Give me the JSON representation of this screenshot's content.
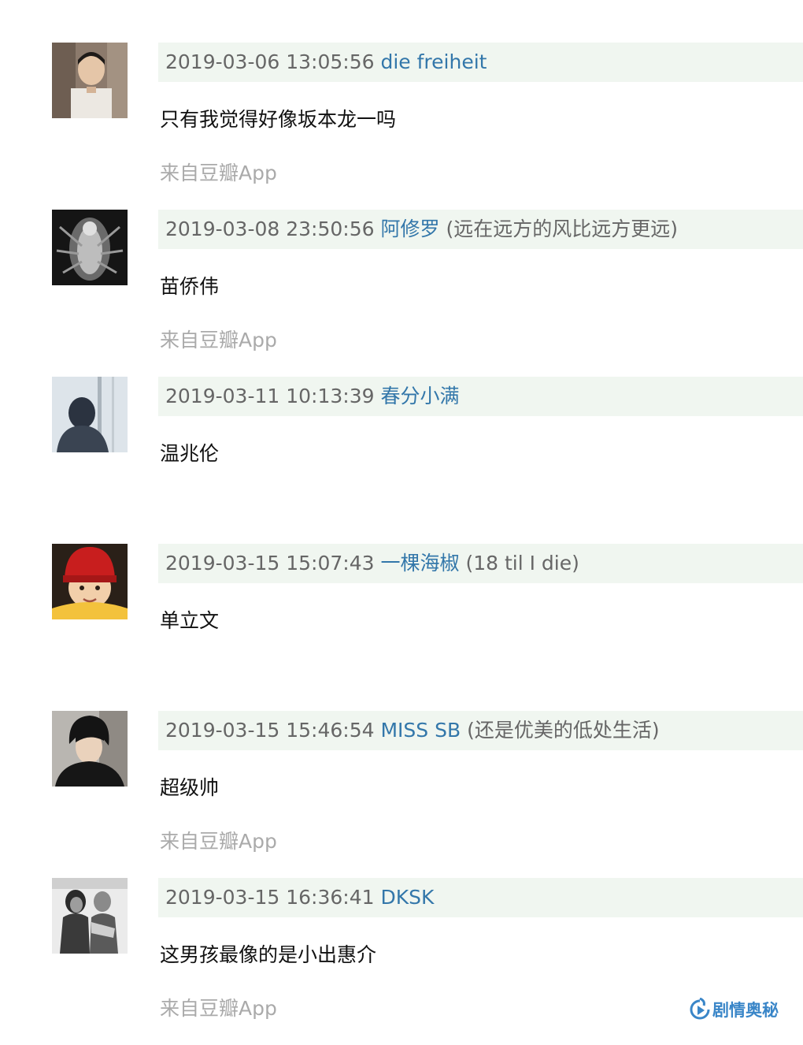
{
  "comments": [
    {
      "time": "2019-03-06 13:05:56",
      "author": "die freiheit",
      "signature": "",
      "content": "只有我觉得好像坂本龙一吗",
      "source": "来自豆瓣App"
    },
    {
      "time": "2019-03-08 23:50:56",
      "author": "阿修罗",
      "signature": "(远在远方的风比远方更远)",
      "content": "苗侨伟",
      "source": "来自豆瓣App"
    },
    {
      "time": "2019-03-11 10:13:39",
      "author": "春分小满",
      "signature": "",
      "content": "温兆伦",
      "source": ""
    },
    {
      "time": "2019-03-15 15:07:43",
      "author": "一棵海椒",
      "signature": "(18 til I die)",
      "content": "单立文",
      "source": ""
    },
    {
      "time": "2019-03-15 15:46:54",
      "author": "MISS SB",
      "signature": "(还是优美的低处生活)",
      "content": "超级帅",
      "source": "来自豆瓣App"
    },
    {
      "time": "2019-03-15 16:36:41",
      "author": "DKSK",
      "signature": "",
      "content": "这男孩最像的是小出惠介",
      "source": "来自豆瓣App"
    }
  ],
  "colors": {
    "header_background": "#f0f6f0",
    "author_link": "#3377aa",
    "timestamp": "#666666",
    "source_text": "#aaaaaa",
    "watermark": "#3a86c8"
  },
  "watermark": {
    "text": "剧情奥秘",
    "icon": "play-logo-icon"
  }
}
